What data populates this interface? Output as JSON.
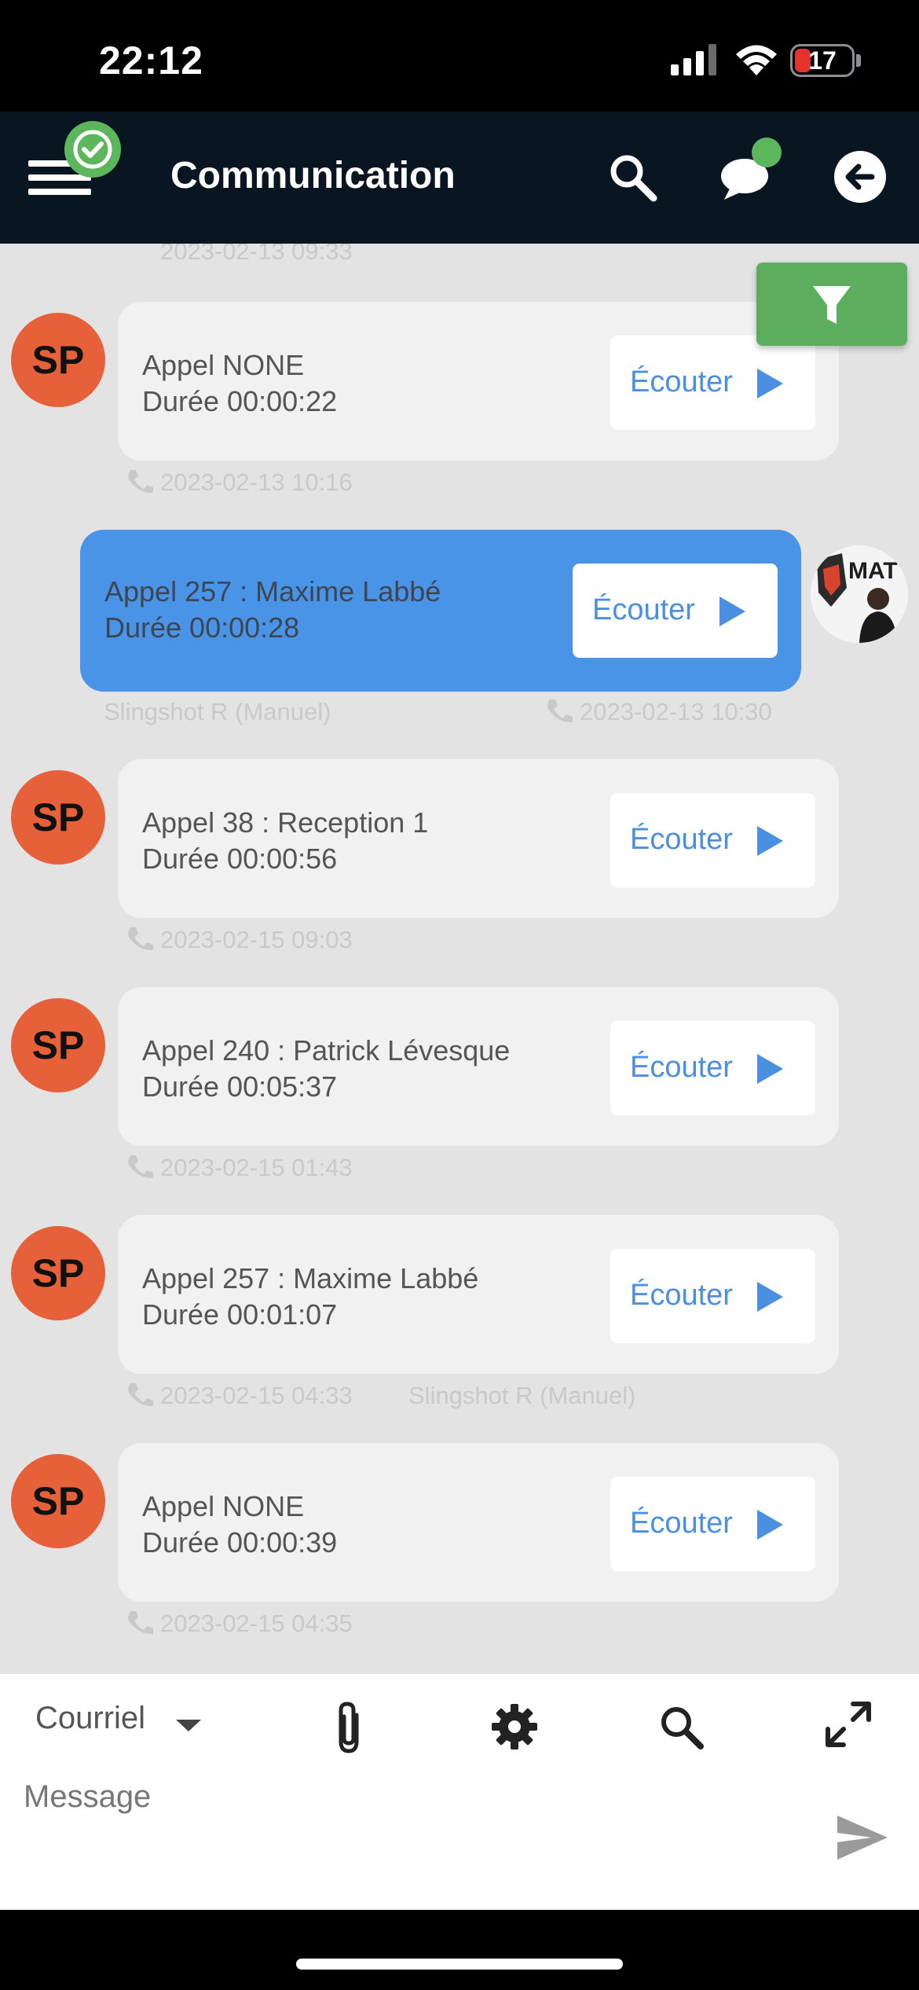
{
  "status_bar": {
    "time": "22:12",
    "battery": "17"
  },
  "app_bar": {
    "title": "Communication"
  },
  "messages": [
    {
      "meta": "2023-02-13 09:33"
    },
    {
      "avatar": "SP",
      "line1": "Appel NONE",
      "line2": "Durée 00:00:22",
      "listen": "Écouter",
      "meta": "2023-02-13 10:16"
    },
    {
      "line1": "Appel 257 : Maxime Labbé",
      "line2": "Durée 00:00:28",
      "listen": "Écouter",
      "meta_user": "Slingshot R (Manuel)",
      "meta": "2023-02-13 10:30"
    },
    {
      "avatar": "SP",
      "line1": "Appel 38 : Reception 1",
      "line2": "Durée 00:00:56",
      "listen": "Écouter",
      "meta": "2023-02-15 09:03"
    },
    {
      "avatar": "SP",
      "line1": "Appel 240 : Patrick Lévesque",
      "line2": "Durée 00:05:37",
      "listen": "Écouter",
      "meta": "2023-02-15 01:43"
    },
    {
      "avatar": "SP",
      "line1": "Appel 257 : Maxime Labbé",
      "line2": "Durée 00:01:07",
      "listen": "Écouter",
      "meta": "2023-02-15 04:33",
      "meta_user": "Slingshot R (Manuel)"
    },
    {
      "avatar": "SP",
      "line1": "Appel NONE",
      "line2": "Durée 00:00:39",
      "listen": "Écouter",
      "meta": "2023-02-15 04:35"
    }
  ],
  "logo": {
    "text": "MAT"
  },
  "composer": {
    "channel": "Courriel",
    "message_placeholder": "Message"
  },
  "colors": {
    "app_bar": "#091521",
    "avatar": "#e6603a",
    "own_bubble": "#4a94e8",
    "listen_text": "#4b8fe1",
    "filter_button": "#5cad5e",
    "online_dot": "#5cb75c"
  },
  "icons": [
    "menu-icon",
    "check-icon",
    "search-icon",
    "chat-icon",
    "back-arrow-icon",
    "filter-icon",
    "phone-icon",
    "play-icon",
    "attach-icon",
    "settings-icon",
    "expand-icon",
    "send-icon"
  ]
}
